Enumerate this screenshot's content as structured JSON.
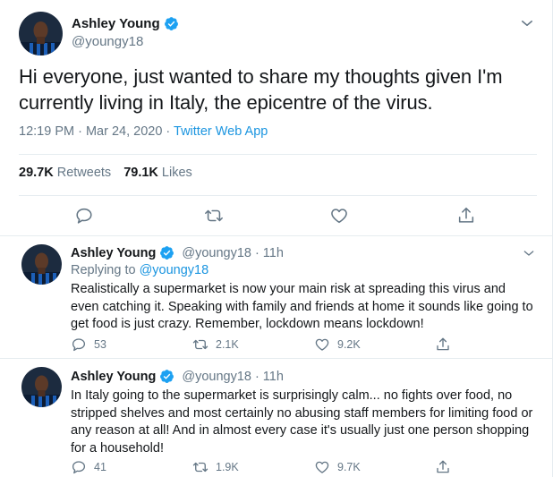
{
  "main_tweet": {
    "display_name": "Ashley Young",
    "handle": "@youngy18",
    "text": "Hi everyone, just wanted to share my thoughts given I'm currently living in Italy, the epicentre of the virus.",
    "time": "12:19 PM · Mar 24, 2020 · ",
    "source": "Twitter Web App",
    "retweets_count": "29.7K",
    "retweets_label": "Retweets",
    "likes_count": "79.1K",
    "likes_label": "Likes"
  },
  "replies": [
    {
      "display_name": "Ashley Young",
      "handle": "@youngy18",
      "dot": "·",
      "time": "11h",
      "replying_prefix": "Replying to ",
      "replying_to": "@youngy18",
      "text": "Realistically a supermarket is now your main risk at spreading this virus and even catching it. Speaking with family and friends at home it sounds like going to get food is just crazy. Remember, lockdown means lockdown!",
      "reply_count": "53",
      "retweet_count": "2.1K",
      "like_count": "9.2K"
    },
    {
      "display_name": "Ashley Young",
      "handle": "@youngy18",
      "dot": "·",
      "time": "11h",
      "text": "In Italy going to the supermarket is surprisingly calm... no fights over food, no stripped shelves and most certainly no abusing staff members for limiting food or any reason at all! And in almost every case it's usually just one person shopping for a household!",
      "reply_count": "41",
      "retweet_count": "1.9K",
      "like_count": "9.7K"
    }
  ],
  "colors": {
    "primary_text": "#14171a",
    "secondary_text": "#657786",
    "link": "#1b95e0",
    "divider": "#e6ecf0",
    "verified_badge": "#1da1f2"
  },
  "icons": [
    "avatar",
    "verified-badge-icon",
    "chevron-down-icon",
    "reply-icon",
    "retweet-icon",
    "like-icon",
    "share-icon"
  ]
}
